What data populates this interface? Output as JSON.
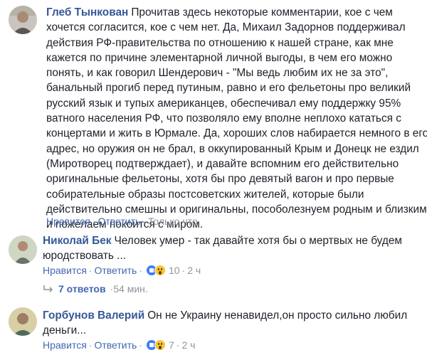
{
  "comments": [
    {
      "author": "Глеб Тынкован",
      "lines": [
        "Прочитав здесь некоторые комментарии, кое с чем",
        "хочется согласится, кое с чем нет. Да, Михаил Задорнов поддерживал",
        "действия РФ-правительства по отношению к нашей стране, как мне",
        "кажется по причине элементарной личной выгоды, в чем его можно",
        "понять, и как говорил Шендерович - \"Мы ведь любим их не за это\",",
        "банальный прогиб перед путиным, равно и его фельетоны про великий",
        "русский язык и тупых американцев, обеспечивал ему поддержку 95%",
        "ватного населения РФ, что позволяло ему вполне неплохо кататься с",
        "концертами и жить в Юрмале. Да, хороших слов набирается немного в его",
        "адрес, но оружия он не брал, в оккупированный Крым и Донецк не ездил",
        "(Миротворец подтверждает), и давайте вспомним его действительно",
        "оригинальные фельетоны, хотя бы про девятый вагон и про первые",
        "собирательные образы постсоветских жителей, которые были",
        "действительно смешны и оригинальны, пособолезнуем родным и близким,",
        "и пожелаем покоится с миром."
      ],
      "like_label": "Нравится",
      "reply_label": "Ответить",
      "time": "Только что",
      "reaction_count": "",
      "avatar_icon": "user-avatar-photo"
    },
    {
      "author": "Николай Бек",
      "lines": [
        "Человек умер - так давайте хотя бы о мертвых не будем",
        "юродствовать ..."
      ],
      "like_label": "Нравится",
      "reply_label": "Ответить",
      "time": "2 ч",
      "reaction_count": "10",
      "avatar_icon": "user-avatar-photo"
    },
    {
      "author": "Горбунов Валерий",
      "lines": [
        "Он не Украину ненавидел,он просто сильно любил",
        "деньги..."
      ],
      "like_label": "Нравится",
      "reply_label": "Ответить",
      "time": "2 ч",
      "reaction_count": "7",
      "avatar_icon": "user-avatar-photo"
    }
  ],
  "replies": {
    "label": "7 ответов",
    "time": "54 мин."
  },
  "colors": {
    "author": "#365899",
    "link": "#4267b2",
    "meta": "#90949c",
    "text": "#1d2129"
  }
}
